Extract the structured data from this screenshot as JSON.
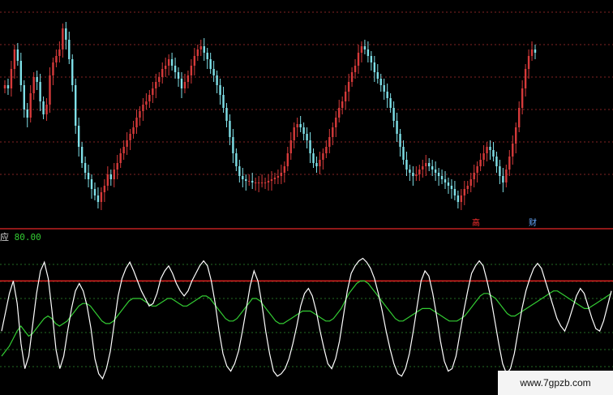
{
  "indicator": {
    "prefix": "应",
    "value_text": "80.00"
  },
  "markers": {
    "left": "高",
    "right": "财"
  },
  "watermark": "www.7gpzb.com",
  "colors": {
    "up_candle": "#d63a3a",
    "down_candle": "#7fe0e8",
    "white_line": "#ffffff",
    "green_line": "#33cc33",
    "grid_upper": "#b03030",
    "grid_lower": "#2f8f2f",
    "level_line": "#e02020",
    "divider": "#c02020"
  },
  "chart_data": [
    {
      "type": "candlestick",
      "grid": true,
      "close": [
        60,
        58,
        70,
        82,
        75,
        60,
        45,
        40,
        55,
        65,
        62,
        50,
        42,
        48,
        66,
        74,
        78,
        82,
        95,
        88,
        76,
        60,
        35,
        22,
        12,
        6,
        2,
        -4,
        -8,
        -12,
        -6,
        -2,
        5,
        2,
        8,
        12,
        18,
        22,
        26,
        30,
        34,
        40,
        44,
        48,
        50,
        54,
        58,
        62,
        65,
        70,
        72,
        76,
        72,
        68,
        64,
        58,
        62,
        66,
        72,
        78,
        82,
        84,
        80,
        76,
        70,
        66,
        60,
        54,
        46,
        38,
        28,
        18,
        10,
        4,
        2,
        1,
        1,
        0,
        0,
        0,
        0,
        0,
        1,
        2,
        3,
        4,
        6,
        10,
        18,
        26,
        34,
        36,
        34,
        30,
        26,
        18,
        12,
        10,
        14,
        18,
        22,
        28,
        34,
        40,
        46,
        50,
        56,
        62,
        68,
        72,
        80,
        84,
        82,
        78,
        74,
        68,
        64,
        60,
        56,
        52,
        46,
        38,
        30,
        22,
        14,
        8,
        6,
        4,
        5,
        8,
        10,
        12,
        10,
        8,
        6,
        4,
        2,
        0,
        -2,
        -4,
        -8,
        -12,
        -8,
        -4,
        -2,
        2,
        6,
        10,
        14,
        18,
        22,
        20,
        16,
        10,
        4,
        0,
        8,
        16,
        24,
        34,
        46,
        58,
        70,
        78,
        82,
        80
      ]
    },
    {
      "type": "line",
      "grid": true,
      "level": 80,
      "series": [
        {
          "color": "white",
          "values": [
            40,
            55,
            70,
            80,
            62,
            30,
            10,
            20,
            45,
            70,
            88,
            95,
            82,
            55,
            25,
            10,
            20,
            40,
            58,
            72,
            78,
            72,
            60,
            42,
            18,
            6,
            2,
            10,
            24,
            46,
            68,
            82,
            90,
            95,
            88,
            80,
            72,
            66,
            60,
            62,
            70,
            82,
            88,
            92,
            86,
            78,
            72,
            68,
            72,
            80,
            86,
            92,
            96,
            92,
            80,
            62,
            40,
            22,
            12,
            8,
            14,
            24,
            40,
            58,
            76,
            88,
            80,
            62,
            40,
            22,
            8,
            4,
            6,
            10,
            18,
            30,
            44,
            60,
            70,
            74,
            68,
            56,
            40,
            26,
            14,
            10,
            18,
            32,
            52,
            72,
            86,
            92,
            96,
            98,
            95,
            90,
            82,
            70,
            56,
            40,
            26,
            14,
            6,
            4,
            10,
            22,
            40,
            60,
            80,
            88,
            84,
            70,
            52,
            32,
            16,
            8,
            10,
            20,
            38,
            56,
            72,
            86,
            92,
            96,
            92,
            80,
            66,
            48,
            30,
            14,
            6,
            10,
            22,
            40,
            58,
            72,
            82,
            90,
            94,
            90,
            80,
            70,
            60,
            50,
            44,
            40,
            48,
            58,
            68,
            74,
            70,
            60,
            50,
            42,
            40,
            48,
            60,
            72
          ]
        },
        {
          "color": "green",
          "values": [
            20,
            24,
            28,
            34,
            40,
            44,
            40,
            36,
            38,
            42,
            46,
            50,
            52,
            50,
            46,
            44,
            46,
            48,
            52,
            56,
            60,
            62,
            62,
            60,
            56,
            52,
            48,
            46,
            46,
            48,
            52,
            56,
            60,
            64,
            66,
            66,
            66,
            64,
            62,
            60,
            60,
            62,
            64,
            66,
            66,
            64,
            62,
            60,
            60,
            62,
            64,
            66,
            68,
            68,
            66,
            62,
            58,
            54,
            50,
            48,
            48,
            50,
            54,
            58,
            62,
            66,
            66,
            64,
            60,
            56,
            52,
            48,
            46,
            46,
            48,
            50,
            52,
            54,
            56,
            56,
            56,
            54,
            52,
            50,
            48,
            48,
            50,
            54,
            58,
            64,
            70,
            74,
            78,
            80,
            80,
            78,
            74,
            70,
            66,
            62,
            58,
            54,
            50,
            48,
            48,
            50,
            52,
            54,
            56,
            58,
            58,
            58,
            56,
            54,
            52,
            50,
            48,
            48,
            48,
            50,
            52,
            56,
            60,
            64,
            68,
            70,
            70,
            68,
            66,
            62,
            58,
            54,
            52,
            52,
            54,
            56,
            58,
            60,
            62,
            64,
            66,
            68,
            70,
            72,
            72,
            70,
            68,
            66,
            64,
            62,
            60,
            58,
            58,
            60,
            62,
            64,
            66,
            68,
            70
          ]
        }
      ]
    }
  ]
}
